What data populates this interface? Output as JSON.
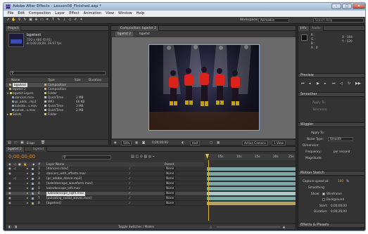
{
  "window": {
    "title": "Adobe After Effects - Lesson08_Finished.aep *",
    "icon_text": "Ae",
    "minimize": "–",
    "maximize": "□",
    "close": "✕"
  },
  "menu": [
    "File",
    "Edit",
    "Composition",
    "Layer",
    "Effect",
    "Animation",
    "View",
    "Window",
    "Help"
  ],
  "toolbar": {
    "workspace_label": "Workspace:",
    "workspace_value": "Animation",
    "search_placeholder": "Search Help"
  },
  "project": {
    "tab": "Project",
    "selected_name": "bgwtext",
    "selected_info1": "720 x 486 (0.91)",
    "selected_info2": "Δ 0;00;26;00, 29.97 fps",
    "columns": [
      "Name",
      "Type",
      "Size",
      "Duration"
    ],
    "items": [
      {
        "name": "bgwtext",
        "type": "Composition",
        "size": "",
        "color": "#c9b15a"
      },
      {
        "name": "bgwtxt 2",
        "type": "Composition",
        "size": "",
        "color": "#c9b15a"
      },
      {
        "name": "bgwtxt Layers",
        "type": "Folder",
        "size": "",
        "color": "#d6c34a"
      },
      {
        "name": "dancers.mov",
        "type": "QuickTime",
        "size": "2 MB",
        "color": "#c4c4c4"
      },
      {
        "name": "gc_adds...mp3",
        "type": "MP3",
        "size": "66 KB",
        "color": "#c4c4c4"
      },
      {
        "name": "kaleido...s.mov",
        "type": "QuickTime",
        "size": "3 MB",
        "color": "#c4c4c4"
      },
      {
        "name": "pulsat...s.mov",
        "type": "QuickTime",
        "size": "2 MB",
        "color": "#c4c4c4"
      },
      {
        "name": "Solids",
        "type": "Folder",
        "size": "",
        "color": "#d6c34a"
      }
    ],
    "footer_bpc": "8 bpc"
  },
  "composition": {
    "tab": "Composition: bgwtxt 2",
    "breadcrumb": [
      "bgwtxt 2",
      "bgwtxt"
    ],
    "zoom": "50%",
    "timecode": "0;00;00;00",
    "resolution": "Half",
    "camera": "Active Camera",
    "views": "1 View"
  },
  "info": {
    "tabs": [
      "Info",
      "Audio"
    ],
    "r": "R :",
    "g": "G :",
    "b": "B :",
    "a": "A : 0",
    "x": "X : 104",
    "y": "Y : 120"
  },
  "preview": {
    "title": "Preview"
  },
  "smoother": {
    "title": "Smoother",
    "apply_to": "Apply To:",
    "tolerance": "Tolerance:"
  },
  "wiggler": {
    "title": "Wiggler",
    "apply_to": "Apply To:",
    "noise_type": "Noise Type:",
    "noise_value": "Smooth",
    "dimension": "Dimension:",
    "frequency": "Frequency:",
    "frequency_unit": "per second",
    "magnitude": "Magnitude:"
  },
  "motion_sketch": {
    "title": "Motion Sketch",
    "capture_speed": "Capture speed at:",
    "capture_value": "100",
    "capture_unit": "%",
    "smoothing": "Smoothing:",
    "show": "Show:",
    "wireframe": "Wireframe",
    "background": "Background",
    "start": "Start:",
    "start_value": "0;00;00;00",
    "duration": "Duration:",
    "duration_value": "0;00;26;00"
  },
  "effects": {
    "title": "Effects & Presets"
  },
  "timeline": {
    "tabs": [
      "bgwtxt 2",
      "bgwtxt"
    ],
    "timecode": "0;00;00;00",
    "search_placeholder": "",
    "col_hash": "#",
    "col_name": "Layer Name",
    "col_parent": "Parent",
    "ruler": [
      "05s",
      "10s",
      "15s",
      "20s",
      "25s"
    ],
    "footer": "Toggle Switches / Modes",
    "layers": [
      {
        "num": "1",
        "name": "[dancers.mov]",
        "parent": "None",
        "color": "#9aa6c8"
      },
      {
        "num": "2",
        "name": "dancers_with_effects.mov",
        "parent": "None",
        "color": "#9aa6c8"
      },
      {
        "num": "3",
        "name": "[gc_adobe_dance.mp3]",
        "parent": "None",
        "color": "#9aa6c8"
      },
      {
        "num": "4",
        "name": "[kaleidoscope_waveform.mov]",
        "parent": "None",
        "color": "#9aa6c8"
      },
      {
        "num": "5",
        "name": "kaleidoscope_left.mov",
        "parent": "None",
        "color": "#9aa6c8"
      },
      {
        "num": "6",
        "name": "kaleidoscope_right.mov",
        "parent": "None",
        "color": "#9aa6c8"
      },
      {
        "num": "7",
        "name": "[pulsating_radial_waves.mov]",
        "parent": "None",
        "color": "#9aa6c8"
      },
      {
        "num": "8",
        "name": "[bgwtext]",
        "parent": "None",
        "color": "#c9b15a"
      }
    ]
  }
}
